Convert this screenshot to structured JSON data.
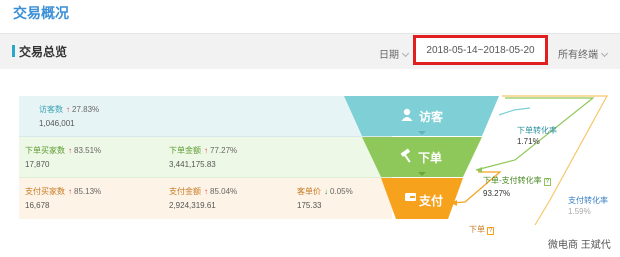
{
  "header": {
    "title": "交易概况"
  },
  "toolbar": {
    "section_title": "交易总览",
    "date_label": "日期",
    "date_range": "2018-05-14~2018-05-20",
    "channel_label": "所有终端"
  },
  "rows": {
    "visitors": {
      "label": "访客数",
      "pct": "27.83%",
      "value": "1,046,001"
    },
    "order_buyers": {
      "label": "下单买家数",
      "pct": "83.51%",
      "value": "17,870"
    },
    "order_amount": {
      "label": "下单金额",
      "pct": "77.27%",
      "value": "3,441,175.83"
    },
    "pay_buyers": {
      "label": "支付买家数",
      "pct": "85.13%",
      "value": "16,678"
    },
    "pay_amount": {
      "label": "支付金额",
      "pct": "85.04%",
      "value": "2,924,319.61"
    },
    "unit_price": {
      "label": "客单价",
      "pct": "0.05%",
      "value": "175.33"
    }
  },
  "funnel": {
    "stage_visit": "访客",
    "stage_order": "下单",
    "stage_pay": "支付"
  },
  "conversions": {
    "order_rate_label": "下单转化率",
    "order_rate_value": "1.71%",
    "order_pay_label": "下单-支付转化率",
    "order_pay_value": "93.27%",
    "pay_rate_label": "支付转化率",
    "pay_rate_value": "1.59%",
    "unknown_label": "下单"
  },
  "watermark": "微电商 王斌代",
  "colors": {
    "teal": "#7ecfd6",
    "green": "#8fc85a",
    "orange": "#f6a21d",
    "accent_red": "#e02020"
  }
}
